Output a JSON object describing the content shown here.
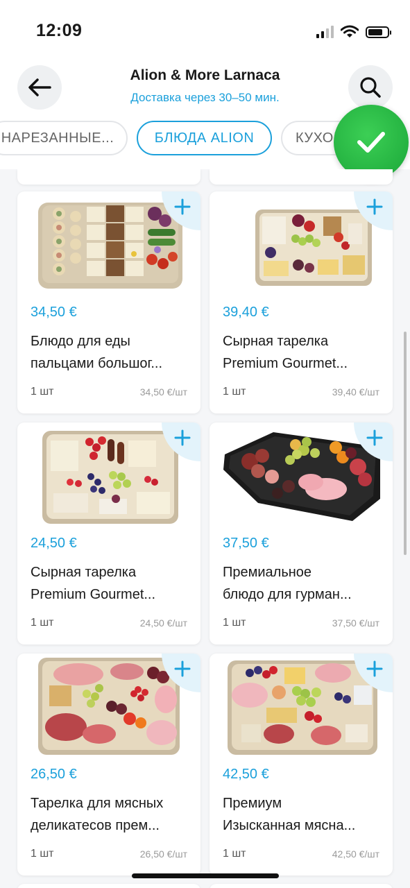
{
  "status_bar": {
    "time": "12:09"
  },
  "header": {
    "title": "Alion & More Larnaca",
    "subtitle": "Доставка через 30–50 мин."
  },
  "tabs": [
    {
      "label": "НАРЕЗАННЫЕ..."
    },
    {
      "label": "БЛЮДА ALION",
      "active": true
    },
    {
      "label": "КУХОН"
    }
  ],
  "colors": {
    "accent": "#1ba0db",
    "check_badge": "#27b840"
  },
  "icons": [
    "back-arrow-icon",
    "search-icon",
    "checkmark-icon",
    "plus-icon"
  ],
  "products": [
    {
      "price": "34,50 €",
      "name_line1": "Блюдо для еды",
      "name_line2": "пальцами большог...",
      "qty": "1 шт",
      "unit_price": "34,50 €/шт",
      "image": "finger-food-platter"
    },
    {
      "price": "39,40 €",
      "name_line1": "Сырная тарелка",
      "name_line2": "Premium Gourmet...",
      "qty": "1 шт",
      "unit_price": "39,40 €/шт",
      "image": "cheese-platter"
    },
    {
      "price": "24,50 €",
      "name_line1": "Сырная тарелка",
      "name_line2": "Premium Gourmet...",
      "qty": "1 шт",
      "unit_price": "24,50 €/шт",
      "image": "cheese-fruit-platter"
    },
    {
      "price": "37,50 €",
      "name_line1": "Премиальное",
      "name_line2": "блюдо для гурман...",
      "qty": "1 шт",
      "unit_price": "37,50 €/шт",
      "image": "meat-fruit-platter"
    },
    {
      "price": "26,50 €",
      "name_line1": "Тарелка для мясных",
      "name_line2": "деликатесов прем...",
      "qty": "1 шт",
      "unit_price": "26,50 €/шт",
      "image": "charcuterie-platter"
    },
    {
      "price": "42,50 €",
      "name_line1": "Премиум",
      "name_line2": "Изысканная мясна...",
      "qty": "1 шт",
      "unit_price": "42,50 €/шт",
      "image": "premium-meat-platter"
    }
  ]
}
